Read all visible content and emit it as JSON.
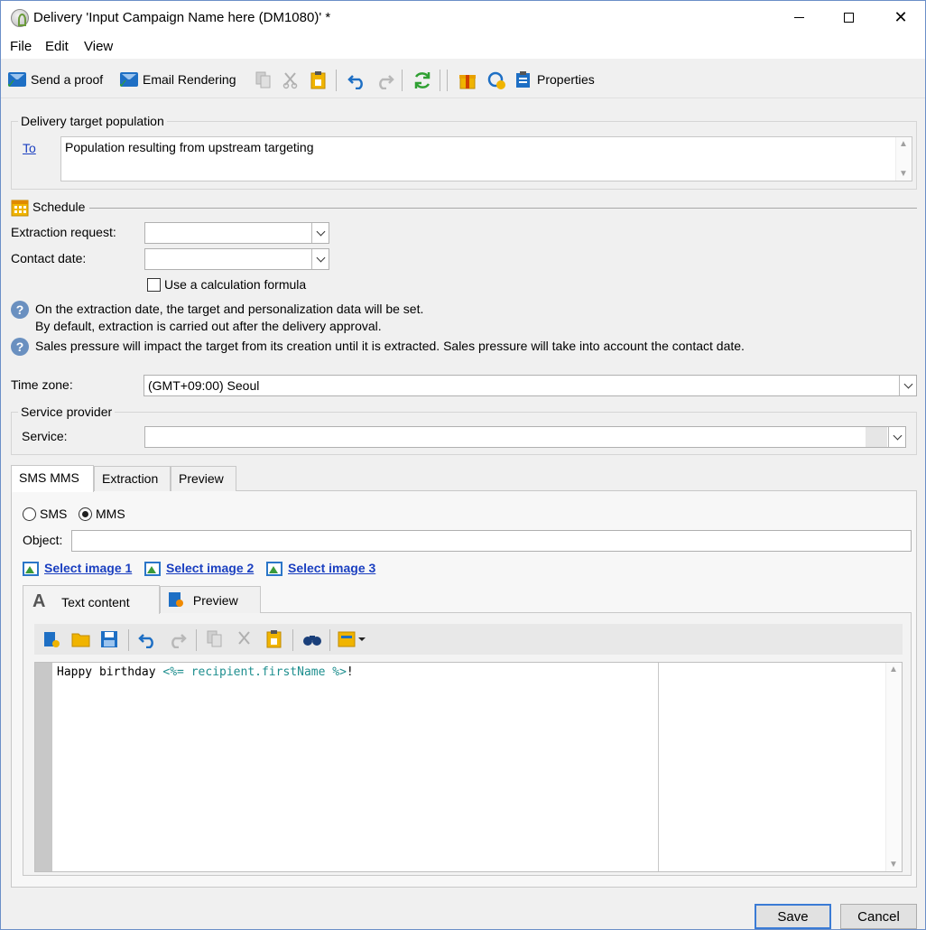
{
  "window": {
    "title": "Delivery 'Input Campaign Name here (DM1080)' *",
    "close_glyph": "✕"
  },
  "menu": {
    "file": "File",
    "edit": "Edit",
    "view": "View"
  },
  "toolbar": {
    "send_proof": "Send a proof",
    "email_rendering": "Email Rendering",
    "properties": "Properties"
  },
  "target": {
    "legend": "Delivery target population",
    "to_link": "To",
    "population_text": "Population resulting from upstream targeting"
  },
  "schedule": {
    "legend": "Schedule",
    "extraction_label": "Extraction request:",
    "extraction_value": "",
    "contact_label": "Contact date:",
    "contact_value": "",
    "formula_label": "Use a calculation formula",
    "info1_line1": "On the extraction date, the target and personalization data will be set.",
    "info1_line2": "By default, extraction is carried out after the delivery approval.",
    "info2": "Sales pressure will impact the target from its creation until it is extracted. Sales pressure will take into account the contact date."
  },
  "timezone": {
    "label": "Time zone:",
    "value": "(GMT+09:00) Seoul"
  },
  "service_provider": {
    "legend": "Service provider",
    "service_label": "Service:",
    "service_value": ""
  },
  "tabs": {
    "sms_mms": "SMS MMS",
    "extraction": "Extraction",
    "preview": "Preview"
  },
  "mms": {
    "radio_sms": "SMS",
    "radio_mms": "MMS",
    "selected": "MMS",
    "object_label": "Object:",
    "object_value": "",
    "select_image_1": "Select image 1",
    "select_image_2": "Select image 2",
    "select_image_3": "Select image 3"
  },
  "editor": {
    "tab_text": "Text content",
    "tab_preview": "Preview",
    "content_plain": "Happy birthday ",
    "content_tag": "<%= recipient.firstName %>",
    "content_end": "!"
  },
  "footer": {
    "save": "Save",
    "cancel": "Cancel"
  },
  "colors": {
    "link": "#1a3fc0",
    "code_tag": "#1f8f8f",
    "accent": "#3a7bd5"
  }
}
